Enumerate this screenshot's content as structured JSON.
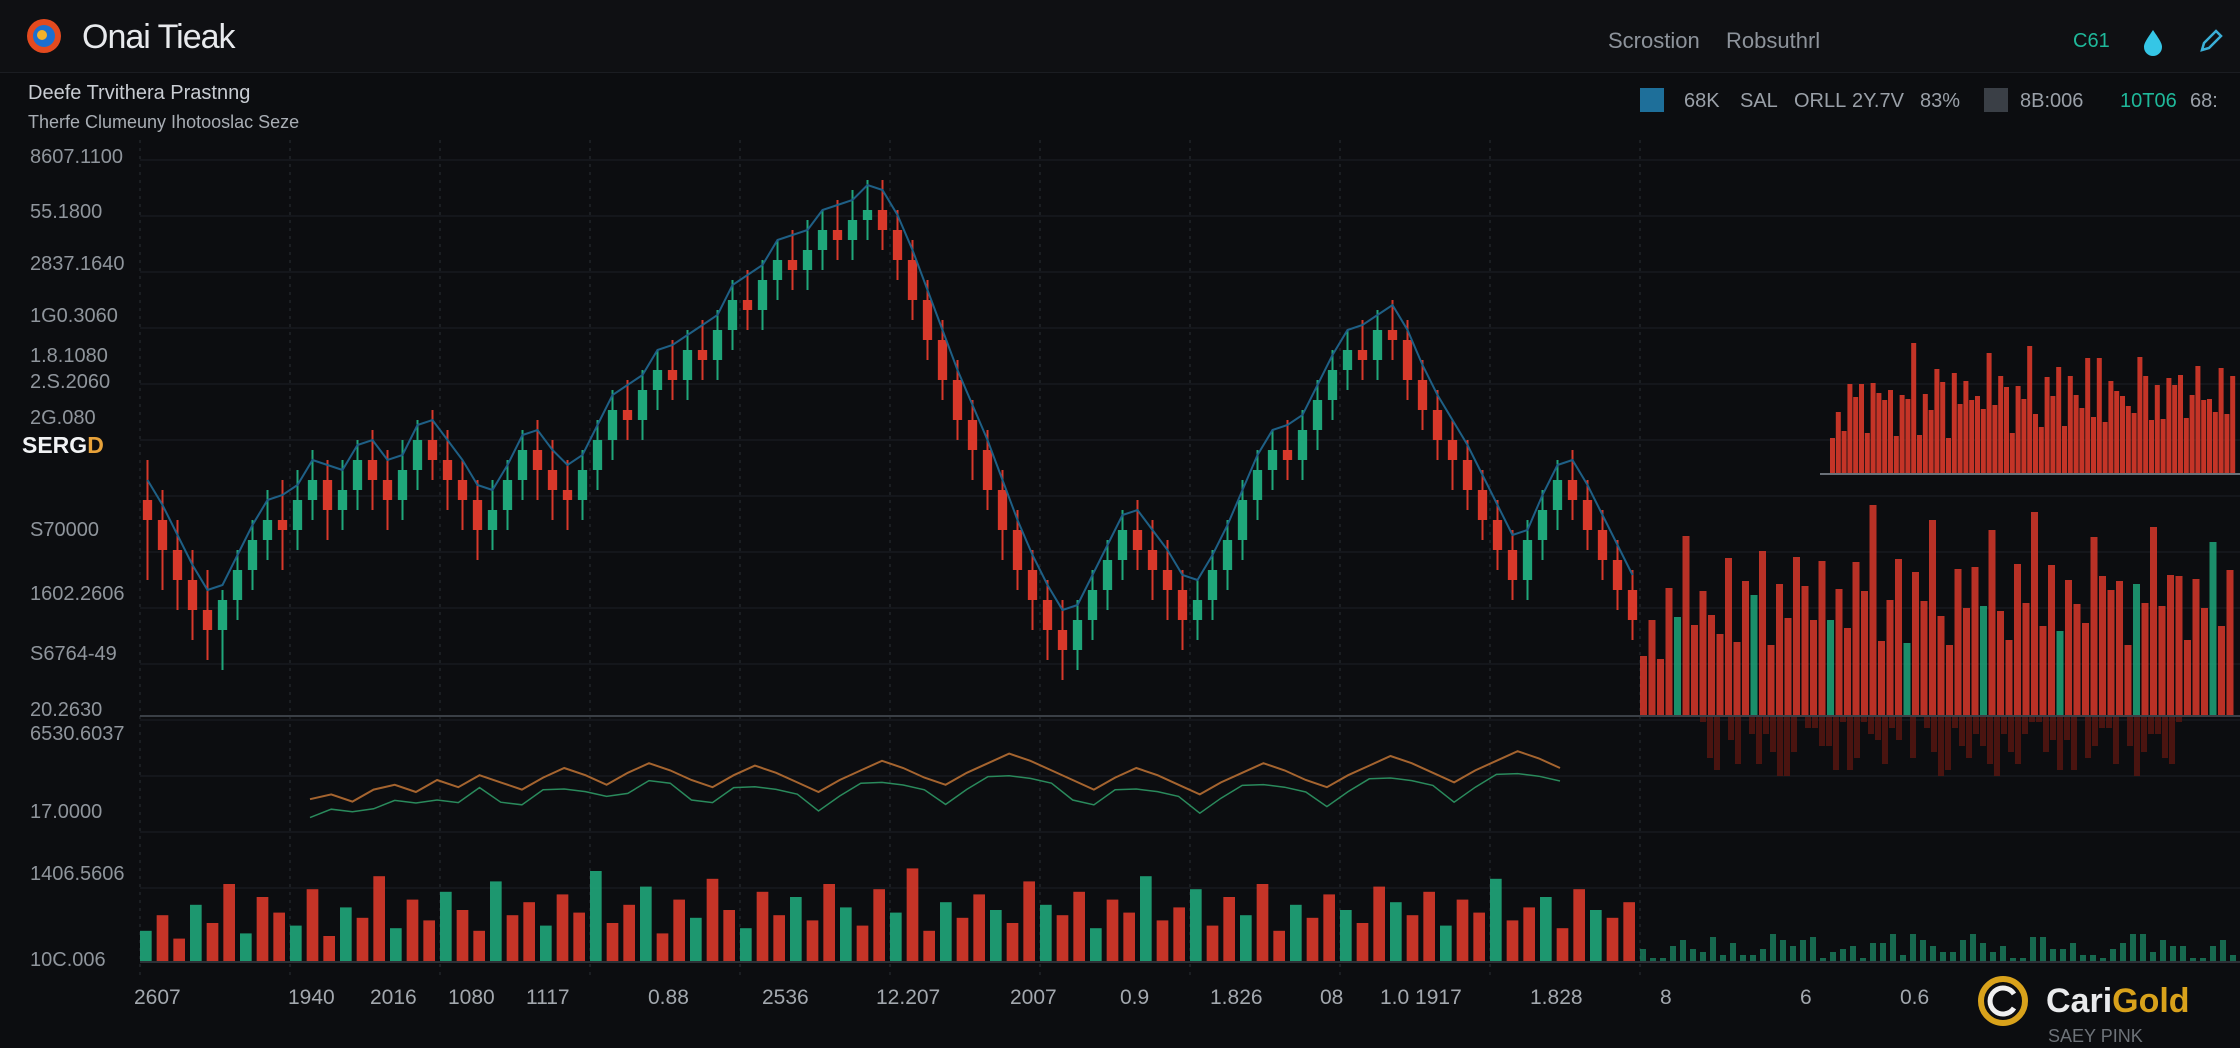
{
  "header": {
    "app_title": "Onai Tieak",
    "nav": [
      "Scrostion",
      "Robsuthrl"
    ],
    "badge": "C61",
    "subtitle_line1": "Deefe Trvithera Prastnng",
    "subtitle_line2": "Therfe Clumeuny Ihotooslac Seze",
    "stats": [
      "68K",
      "SAL",
      "ORLL",
      "2Y.7V",
      "83%",
      "8B:006",
      "10T06",
      "68:"
    ]
  },
  "series_label": "SERG",
  "series_label_suffix": "D",
  "brand": {
    "name_main": "Cari",
    "name_accent": "Gold",
    "caption": "SAEY PINK"
  },
  "colors": {
    "up": "#1fa67a",
    "down": "#d8382a",
    "line": "#1e5f85",
    "grid": "#2a2e35",
    "accent": "#d9a21b"
  },
  "chart_data": {
    "type": "candlestick",
    "y_tick_labels": [
      "8607.1100",
      "55.1800",
      "2837.1640",
      "1G0.3060",
      "1.8.1080",
      "2.S.2060",
      "2G.080",
      "S70000",
      "1602.2606",
      "S6764-49",
      "20.2630",
      "6530.6037",
      "17.0000",
      "1406.5606",
      "10C.006"
    ],
    "x_tick_labels": [
      "2607",
      "1940",
      "2016",
      "1080",
      "1117",
      "0.88",
      "2536",
      "12.207",
      "2007",
      "0.9",
      "1.826",
      "08",
      "1.0 1917",
      "1.828",
      "8",
      "6",
      "0.6"
    ],
    "ohlc": [
      [
        60,
        58,
        64,
        52
      ],
      [
        58,
        55,
        61,
        51
      ],
      [
        55,
        52,
        58,
        49
      ],
      [
        52,
        49,
        55,
        46
      ],
      [
        49,
        47,
        53,
        44
      ],
      [
        47,
        50,
        51,
        43
      ],
      [
        50,
        53,
        55,
        48
      ],
      [
        53,
        56,
        58,
        51
      ],
      [
        56,
        58,
        61,
        54
      ],
      [
        58,
        57,
        62,
        53
      ],
      [
        57,
        60,
        63,
        55
      ],
      [
        60,
        62,
        65,
        58
      ],
      [
        62,
        59,
        64,
        56
      ],
      [
        59,
        61,
        64,
        57
      ],
      [
        61,
        64,
        66,
        59
      ],
      [
        64,
        62,
        67,
        59
      ],
      [
        62,
        60,
        65,
        57
      ],
      [
        60,
        63,
        66,
        58
      ],
      [
        63,
        66,
        68,
        61
      ],
      [
        66,
        64,
        69,
        62
      ],
      [
        64,
        62,
        67,
        59
      ],
      [
        62,
        60,
        64,
        57
      ],
      [
        60,
        57,
        62,
        54
      ],
      [
        57,
        59,
        62,
        55
      ],
      [
        59,
        62,
        64,
        57
      ],
      [
        62,
        65,
        67,
        60
      ],
      [
        65,
        63,
        68,
        60
      ],
      [
        63,
        61,
        66,
        58
      ],
      [
        61,
        60,
        64,
        57
      ],
      [
        60,
        63,
        65,
        58
      ],
      [
        63,
        66,
        68,
        61
      ],
      [
        66,
        69,
        71,
        64
      ],
      [
        69,
        68,
        72,
        66
      ],
      [
        68,
        71,
        73,
        66
      ],
      [
        71,
        73,
        75,
        69
      ],
      [
        73,
        72,
        76,
        70
      ],
      [
        72,
        75,
        77,
        70
      ],
      [
        75,
        74,
        78,
        72
      ],
      [
        74,
        77,
        79,
        72
      ],
      [
        77,
        80,
        82,
        75
      ],
      [
        80,
        79,
        83,
        77
      ],
      [
        79,
        82,
        84,
        77
      ],
      [
        82,
        84,
        86,
        80
      ],
      [
        84,
        83,
        87,
        81
      ],
      [
        83,
        85,
        88,
        81
      ],
      [
        85,
        87,
        89,
        83
      ],
      [
        87,
        86,
        90,
        84
      ],
      [
        86,
        88,
        91,
        84
      ],
      [
        88,
        89,
        92,
        86
      ],
      [
        89,
        87,
        92,
        85
      ],
      [
        87,
        84,
        89,
        82
      ],
      [
        84,
        80,
        86,
        78
      ],
      [
        80,
        76,
        82,
        74
      ],
      [
        76,
        72,
        78,
        70
      ],
      [
        72,
        68,
        74,
        66
      ],
      [
        68,
        65,
        70,
        62
      ],
      [
        65,
        61,
        67,
        59
      ],
      [
        61,
        57,
        63,
        54
      ],
      [
        57,
        53,
        59,
        51
      ],
      [
        53,
        50,
        55,
        47
      ],
      [
        50,
        47,
        52,
        44
      ],
      [
        47,
        45,
        50,
        42
      ],
      [
        45,
        48,
        50,
        43
      ],
      [
        48,
        51,
        53,
        46
      ],
      [
        51,
        54,
        56,
        49
      ],
      [
        54,
        57,
        59,
        52
      ],
      [
        57,
        55,
        60,
        53
      ],
      [
        55,
        53,
        58,
        50
      ],
      [
        53,
        51,
        56,
        48
      ],
      [
        51,
        48,
        53,
        45
      ],
      [
        48,
        50,
        52,
        46
      ],
      [
        50,
        53,
        55,
        48
      ],
      [
        53,
        56,
        58,
        51
      ],
      [
        56,
        60,
        62,
        54
      ],
      [
        60,
        63,
        65,
        58
      ],
      [
        63,
        65,
        67,
        61
      ],
      [
        65,
        64,
        68,
        62
      ],
      [
        64,
        67,
        69,
        62
      ],
      [
        67,
        70,
        72,
        65
      ],
      [
        70,
        73,
        75,
        68
      ],
      [
        73,
        75,
        77,
        71
      ],
      [
        75,
        74,
        78,
        72
      ],
      [
        74,
        77,
        79,
        72
      ],
      [
        77,
        76,
        80,
        74
      ],
      [
        76,
        72,
        78,
        70
      ],
      [
        72,
        69,
        74,
        67
      ],
      [
        69,
        66,
        71,
        64
      ],
      [
        66,
        64,
        68,
        61
      ],
      [
        64,
        61,
        66,
        59
      ],
      [
        61,
        58,
        63,
        56
      ],
      [
        58,
        55,
        60,
        53
      ],
      [
        55,
        52,
        57,
        50
      ],
      [
        52,
        56,
        58,
        50
      ],
      [
        56,
        59,
        61,
        54
      ],
      [
        59,
        62,
        64,
        57
      ],
      [
        62,
        60,
        65,
        58
      ],
      [
        60,
        57,
        62,
        55
      ],
      [
        57,
        54,
        59,
        52
      ],
      [
        54,
        51,
        56,
        49
      ],
      [
        51,
        48,
        53,
        46
      ]
    ],
    "ylim": [
      40,
      95
    ],
    "osc_values": [
      42,
      44,
      41,
      46,
      48,
      45,
      50,
      47,
      52,
      49,
      46,
      51,
      55,
      52,
      48,
      53,
      57,
      54,
      50,
      47,
      52,
      56,
      53,
      49,
      45,
      50,
      54,
      58,
      55,
      51,
      48,
      53,
      57,
      61,
      58,
      54,
      50,
      46,
      51,
      55,
      52,
      48,
      44,
      49,
      53,
      57,
      54,
      50,
      47,
      52,
      56,
      60,
      57,
      53,
      49,
      54,
      58,
      62,
      59,
      55
    ],
    "volumes": [
      12,
      18,
      9,
      22,
      15,
      30,
      11,
      25,
      19,
      14,
      28,
      10,
      21,
      17,
      33,
      13,
      24,
      16,
      27,
      20,
      12,
      31,
      18,
      23,
      14,
      26,
      19,
      35,
      15,
      22,
      29,
      11,
      24,
      17,
      32,
      20,
      13,
      27,
      18,
      25,
      16,
      30,
      21,
      14,
      28,
      19,
      36,
      12,
      23,
      17,
      26,
      20,
      15,
      31,
      22,
      18,
      27,
      13,
      24,
      19,
      33,
      16,
      21,
      28,
      14,
      25,
      18,
      30,
      12,
      22,
      17,
      26,
      20,
      15,
      29,
      23,
      18,
      27,
      14,
      24,
      19,
      32,
      16,
      21,
      25,
      13,
      28,
      20,
      17,
      23
    ]
  }
}
